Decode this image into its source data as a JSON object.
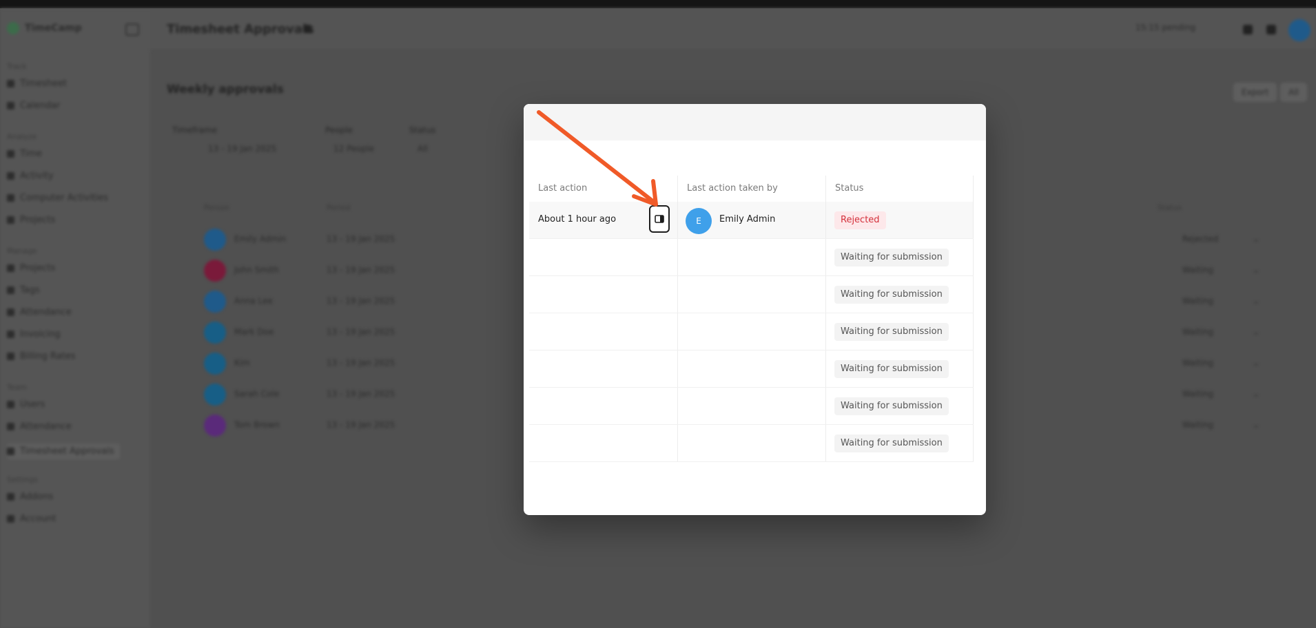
{
  "background_app": {
    "brand": "TimeCamp",
    "header_title": "Timesheet Approvals",
    "header_status": "15:15 pending",
    "page_title": "Weekly approvals",
    "buttons": [
      "Export",
      "All"
    ],
    "filters": [
      {
        "label": "Timeframe",
        "value": "13 - 19 Jan 2025"
      },
      {
        "label": "People",
        "value": "12 People"
      },
      {
        "label": "Status",
        "value": "All"
      }
    ],
    "sidebar": {
      "sections": [
        {
          "title": "Track",
          "items": [
            "Timesheet",
            "Calendar"
          ]
        },
        {
          "title": "Analyze",
          "items": [
            "Time",
            "Activity",
            "Computer Activities",
            "Projects"
          ]
        },
        {
          "title": "Manage",
          "items": [
            "Projects",
            "Tags",
            "Attendance",
            "Invoicing",
            "Billing Rates"
          ]
        },
        {
          "title": "Team",
          "items": [
            "Users",
            "Attendance",
            "Timesheet Approvals"
          ]
        },
        {
          "title": "Settings",
          "items": [
            "Addons",
            "Account"
          ]
        }
      ]
    },
    "table_headers": [
      "Person",
      "Period",
      "Status"
    ],
    "rows": [
      {
        "name": "Emily Admin",
        "period": "13 - 19 Jan 2025",
        "status": "Rejected",
        "color": "#1f5a8a"
      },
      {
        "name": "John Smith",
        "period": "13 - 19 Jan 2025",
        "status": "Waiting",
        "color": "#7a1a3a"
      },
      {
        "name": "Anna Lee",
        "period": "13 - 19 Jan 2025",
        "status": "Waiting",
        "color": "#1f5a8a"
      },
      {
        "name": "Mark Doe",
        "period": "13 - 19 Jan 2025",
        "status": "Waiting",
        "color": "#175e86"
      },
      {
        "name": "Kim",
        "period": "13 - 19 Jan 2025",
        "status": "Waiting",
        "color": "#175e86"
      },
      {
        "name": "Sarah Cole",
        "period": "13 - 19 Jan 2025",
        "status": "Waiting",
        "color": "#175e86"
      },
      {
        "name": "Tom Brown",
        "period": "13 - 19 Jan 2025",
        "status": "Waiting",
        "color": "#5a2a7a"
      }
    ]
  },
  "modal": {
    "columns": {
      "last_action": "Last action",
      "taken_by": "Last action taken by",
      "status": "Status"
    },
    "rows": [
      {
        "last_action": "About 1 hour ago",
        "user_initial": "E",
        "user_name": "Emily Admin",
        "status": "Rejected",
        "status_type": "rejected"
      },
      {
        "last_action": "",
        "user_initial": "",
        "user_name": "",
        "status": "Waiting for submission",
        "status_type": "waiting"
      },
      {
        "last_action": "",
        "user_initial": "",
        "user_name": "",
        "status": "Waiting for submission",
        "status_type": "waiting"
      },
      {
        "last_action": "",
        "user_initial": "",
        "user_name": "",
        "status": "Waiting for submission",
        "status_type": "waiting"
      },
      {
        "last_action": "",
        "user_initial": "",
        "user_name": "",
        "status": "Waiting for submission",
        "status_type": "waiting"
      },
      {
        "last_action": "",
        "user_initial": "",
        "user_name": "",
        "status": "Waiting for submission",
        "status_type": "waiting"
      },
      {
        "last_action": "",
        "user_initial": "",
        "user_name": "",
        "status": "Waiting for submission",
        "status_type": "waiting"
      }
    ]
  },
  "icons": {
    "panel": "side-panel-icon",
    "arrow": "annotation-arrow-icon"
  },
  "colors": {
    "annotation": "#f05a28",
    "rejected_text": "#d4303b",
    "rejected_bg": "#fde8ea",
    "avatar": "#3fa0ea"
  }
}
